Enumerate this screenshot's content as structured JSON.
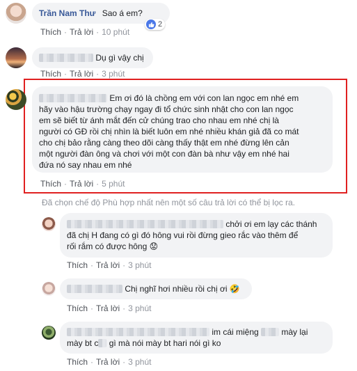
{
  "comments": [
    {
      "author": "Trần Nam Thư",
      "text": "Sao á em?",
      "like_label": "Thích",
      "reply_label": "Trả lời",
      "time": "10 phút",
      "reaction_count": "2"
    },
    {
      "text_visible": "Dụ gì vậy chị",
      "like_label": "Thích",
      "reply_label": "Trả lời",
      "time": "3 phút"
    },
    {
      "lines": [
        "Em ơi đó là chồng em với con lan ngọc em nhé em",
        "hãy vào hậu trường chạy ngay đi tổ chức sinh nhật cho con lan ngọc",
        "em sẽ biết từ ánh mắt đến cử chúng trao cho nhau em nhé chị là",
        "người có GĐ rồi chị nhìn là biết luôn em nhé nhiều khán giả đã co mát",
        "cho chị bảo rằng càng theo dõi càng thấy thật em nhé đừng lên cản",
        "một người đàn ông và chơi với một con đàn bà như vậy em nhé hai",
        "đứa nó say nhau em nhé"
      ],
      "like_label": "Thích",
      "reply_label": "Trả lời",
      "time": "5 phút"
    }
  ],
  "filter_notice": "Đã chọn chế độ Phù hợp nhất nên một số câu trả lời có thể bị lọc ra.",
  "replies": [
    {
      "lines_part1": "chởi ơi em lạy các thánh",
      "lines": [
        "đã chị H đang có gì đó hông vui rồi đừng gieo rắc vào thêm để",
        "rối rắm có được hông"
      ],
      "emoji": "😟",
      "like_label": "Thích",
      "reply_label": "Trả lời",
      "time": "3 phút"
    },
    {
      "text_visible": "Chị nghĩ hơi nhiều rồi chị ơi",
      "emoji": "🤣",
      "like_label": "Thích",
      "reply_label": "Trả lời",
      "time": "3 phút"
    },
    {
      "line1_part1": "im cái miệng",
      "line1_part2": "mày lại",
      "line2_part1": "mày bt c",
      "line2_part2": "gì mà nói mày bt hari nói gì ko",
      "like_label": "Thích",
      "reply_label": "Trả lời",
      "time": "3 phút"
    }
  ],
  "colors": {
    "link": "#385898",
    "bubble": "#f2f3f5",
    "meta": "#90949c",
    "highlight_box": "#e02020",
    "like": "#4b78e8"
  }
}
